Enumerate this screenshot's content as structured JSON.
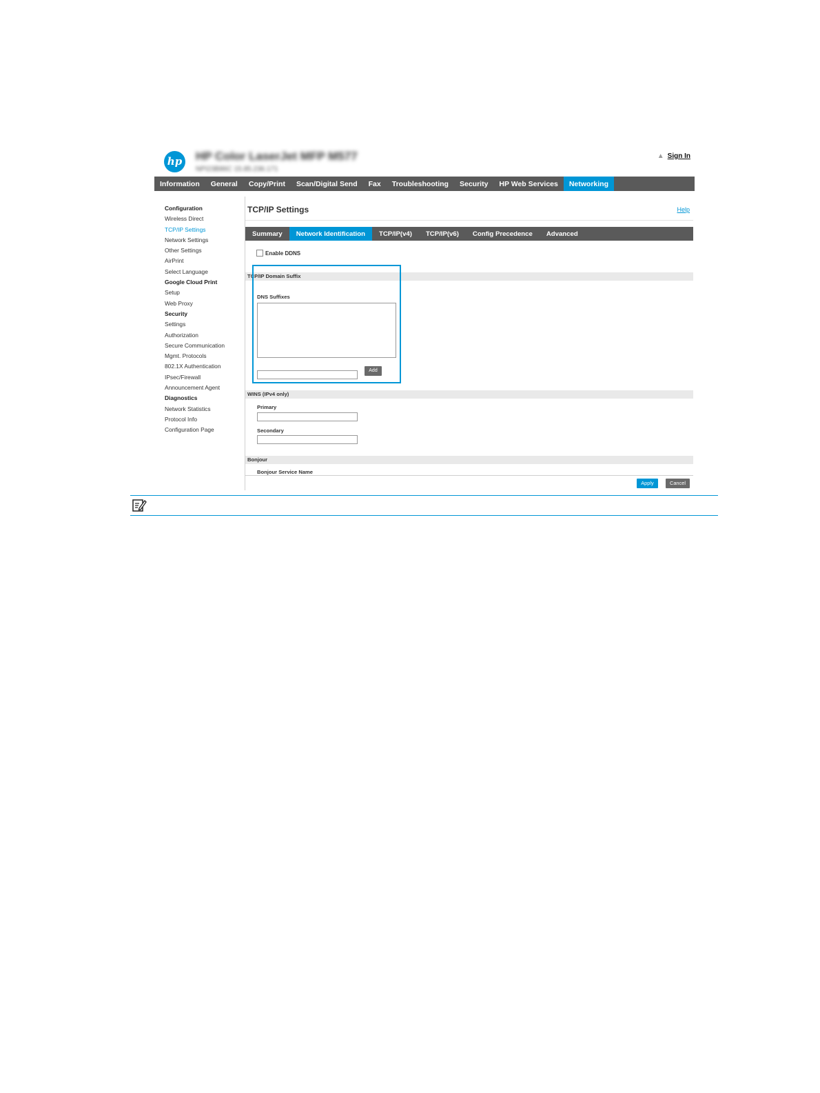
{
  "header": {
    "product_title": "HP Color LaserJet MFP M577",
    "product_subtitle": "NPI23B86C   15.85.236.171",
    "home_icon": "home-icon",
    "sign_in": "Sign In"
  },
  "topnav": {
    "tabs": [
      "Information",
      "General",
      "Copy/Print",
      "Scan/Digital Send",
      "Fax",
      "Troubleshooting",
      "Security",
      "HP Web Services",
      "Networking"
    ],
    "active": "Networking"
  },
  "sidebar": {
    "items": [
      {
        "label": "Configuration",
        "type": "heading"
      },
      {
        "label": "Wireless Direct",
        "type": "link"
      },
      {
        "label": "TCP/IP Settings",
        "type": "selected"
      },
      {
        "label": "Network Settings",
        "type": "link"
      },
      {
        "label": "Other Settings",
        "type": "link"
      },
      {
        "label": "AirPrint",
        "type": "link"
      },
      {
        "label": "Select Language",
        "type": "link"
      },
      {
        "label": "Google Cloud Print",
        "type": "heading"
      },
      {
        "label": "Setup",
        "type": "link"
      },
      {
        "label": "Web Proxy",
        "type": "link"
      },
      {
        "label": "Security",
        "type": "heading"
      },
      {
        "label": "Settings",
        "type": "link"
      },
      {
        "label": "Authorization",
        "type": "link"
      },
      {
        "label": "Secure Communication",
        "type": "link"
      },
      {
        "label": "Mgmt. Protocols",
        "type": "link"
      },
      {
        "label": "802.1X Authentication",
        "type": "link"
      },
      {
        "label": "IPsec/Firewall",
        "type": "link"
      },
      {
        "label": "Announcement Agent",
        "type": "link"
      },
      {
        "label": "Diagnostics",
        "type": "heading"
      },
      {
        "label": "Network Statistics",
        "type": "link"
      },
      {
        "label": "Protocol Info",
        "type": "link"
      },
      {
        "label": "Configuration Page",
        "type": "link"
      }
    ]
  },
  "main": {
    "page_title": "TCP/IP Settings",
    "help": "Help",
    "subtabs": [
      "Summary",
      "Network Identification",
      "TCP/IP(v4)",
      "TCP/IP(v6)",
      "Config Precedence",
      "Advanced"
    ],
    "active_subtab": "Network Identification",
    "enable_ddns_label": "Enable DDNS",
    "enable_ddns_checked": false,
    "domain_suffix": {
      "header": "TCP/IP Domain Suffix",
      "dns_suffixes_label": "DNS Suffixes",
      "dns_suffixes_value": "",
      "new_suffix_value": "",
      "add_label": "Add"
    },
    "wins": {
      "header": "WINS (IPv4 only)",
      "primary_label": "Primary",
      "primary_value": "",
      "secondary_label": "Secondary",
      "secondary_value": ""
    },
    "bonjour": {
      "header": "Bonjour",
      "service_name_label": "Bonjour Service Name"
    },
    "apply_label": "Apply",
    "cancel_label": "Cancel"
  },
  "note": {
    "icon": "note-icon",
    "accent_color": "#0096d6"
  },
  "colors": {
    "accent": "#0096d6",
    "nav_bg": "#5a5a5a"
  }
}
